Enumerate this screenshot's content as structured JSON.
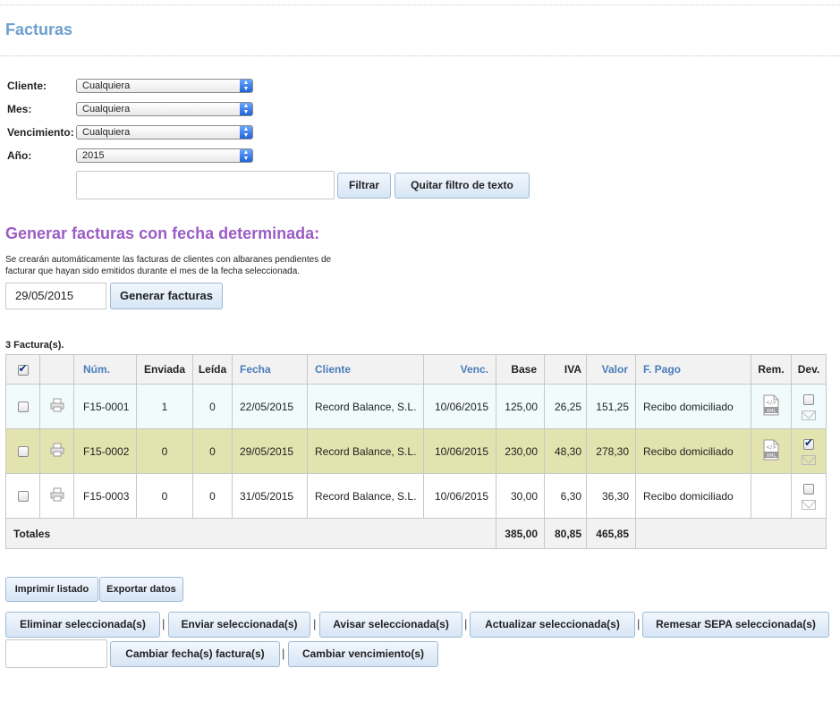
{
  "page": {
    "title": "Facturas"
  },
  "filters": [
    {
      "label": "Cliente:",
      "value": "Cualquiera"
    },
    {
      "label": "Mes:",
      "value": "Cualquiera"
    },
    {
      "label": "Vencimiento:",
      "value": "Cualquiera"
    },
    {
      "label": "Año:",
      "value": "2015"
    }
  ],
  "text_filter": {
    "value": "",
    "filter_label": "Filtrar",
    "clear_label": "Quitar filtro de texto"
  },
  "generate": {
    "title": "Generar facturas con fecha determinada:",
    "description": "Se crearán automáticamente las facturas de clientes con albaranes pendientes de facturar que hayan sido emitidos durante el mes de la fecha seleccionada.",
    "date": "29/05/2015",
    "button": "Generar facturas"
  },
  "table": {
    "count": "3 Factura(s).",
    "headers": {
      "num": "Núm.",
      "sent": "Enviada",
      "read": "Leída",
      "date": "Fecha",
      "client": "Cliente",
      "due": "Venc.",
      "base": "Base",
      "iva": "IVA",
      "value": "Valor",
      "payment": "F. Pago",
      "rem": "Rem.",
      "dev": "Dev."
    },
    "rows": [
      {
        "num": "F15-0001",
        "sent": "1",
        "read": "0",
        "date": "22/05/2015",
        "client": "Record Balance, S.L.",
        "due": "10/06/2015",
        "base": "125,00",
        "iva": "26,25",
        "value": "151,25",
        "payment": "Recibo domiciliado",
        "rem_icon": "xml-file-icon",
        "dev_checked": false
      },
      {
        "num": "F15-0002",
        "sent": "0",
        "read": "0",
        "date": "29/05/2015",
        "client": "Record Balance, S.L.",
        "due": "10/06/2015",
        "base": "230,00",
        "iva": "48,30",
        "value": "278,30",
        "payment": "Recibo domiciliado",
        "rem_icon": "xml-file-icon",
        "dev_checked": true
      },
      {
        "num": "F15-0003",
        "sent": "0",
        "read": "0",
        "date": "31/05/2015",
        "client": "Record Balance, S.L.",
        "due": "10/06/2015",
        "base": "30,00",
        "iva": "6,30",
        "value": "36,30",
        "payment": "Recibo domiciliado",
        "rem_icon": "",
        "dev_checked": false
      }
    ],
    "totals": {
      "label": "Totales",
      "base": "385,00",
      "iva": "80,85",
      "value": "465,85"
    }
  },
  "actions": {
    "print": "Imprimir listado",
    "export": "Exportar datos",
    "delete": "Eliminar seleccionada(s)",
    "send": "Enviar seleccionada(s)",
    "notify": "Avisar seleccionada(s)",
    "update": "Actualizar seleccionada(s)",
    "sepa": "Remesar SEPA seleccionada(s)",
    "change_date_value": "",
    "change_date": "Cambiar fecha(s) factura(s)",
    "change_due": "Cambiar vencimiento(s)",
    "separator": "|"
  },
  "colors": {
    "title": "#6d9fcf",
    "section_title": "#9b5cc4",
    "link_header": "#4a7db8",
    "row_selected": "#e3e3b0",
    "row_alt": "#f1fbfb"
  }
}
